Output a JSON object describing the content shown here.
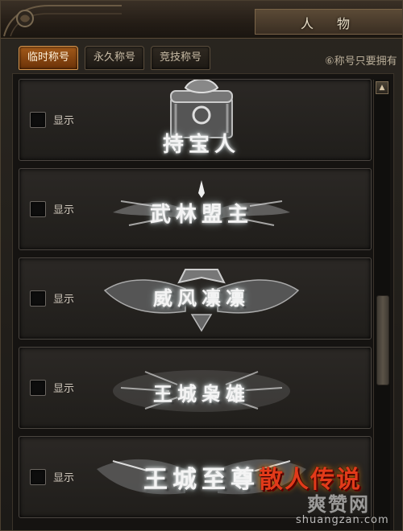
{
  "window": {
    "title": "人 物"
  },
  "tabs": [
    {
      "label": "临时称号",
      "active": true
    },
    {
      "label": "永久称号",
      "active": false
    },
    {
      "label": "竞技称号",
      "active": false
    }
  ],
  "hint_text": "⑥称号只要拥有",
  "titles": [
    {
      "show_label": "显示",
      "badge": "持宝人",
      "checked": false
    },
    {
      "show_label": "显示",
      "badge": "武林盟主",
      "checked": false
    },
    {
      "show_label": "显示",
      "badge": "威风凛凛",
      "checked": false
    },
    {
      "show_label": "显示",
      "badge": "王城枭雄",
      "checked": false
    },
    {
      "show_label": "显示",
      "badge": "王城至尊",
      "checked": false
    }
  ],
  "scrollbar": {
    "up_arrow": "▲"
  },
  "watermark": {
    "logo": "散人传说",
    "site_cn": "爽赞网",
    "site_url": "shuangzan.com"
  },
  "colors": {
    "accent_tab": "#a35a1a",
    "frame": "#4a3f30",
    "badge_glow": "#ffffff",
    "watermark_red": "#e23a1a"
  }
}
